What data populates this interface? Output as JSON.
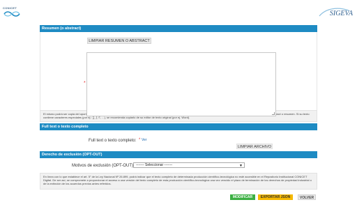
{
  "header": {
    "left_logo_text": "CONICET",
    "right_logo_text": "SIGEVA"
  },
  "resumen": {
    "section_title": "Resumen (o abstract)",
    "clear_button": "LIMPIAR RESUMEN O ABSTRACT",
    "textarea_value": "",
    "required_mark": "*",
    "info_text": "El mismo podrá ser copia del oportunamente enviado a la editorial y en el idioma de la publicación. Puede copiar (ctrl+c) el abstract y pegarlo (ctrl+v) en el cuadro de texto bajo el título Abstract o resumen. Si su texto contiene caracteres especiales (por ej.: ∑, ∫, ℂ, ...), se recomienda copiarlo de su editor de texto original (por ej. Word)."
  },
  "fulltext": {
    "section_title": "Full text o texto completo",
    "label": "Full text o texto completo:",
    "required_mark": "*",
    "ver_link": "Ver",
    "clear_button": "LIMPIAR ARCHIVO"
  },
  "optout": {
    "section_title": "Derecho de exclusión (OPT-OUT)",
    "label": "Motivos de exclusión (OPT-OUT):",
    "select_value": "------- Seleccionar -------",
    "info_text": "En línea con lo que establece el art. 5° de la Ley Nacional Nº 26.899, podrá indicar que el texto completo de determinada producción científico-tecnológica no esté accesible en el Repositorio Institucional CONICET Digital. De ser así, se compromete a proporcionar el acceso a una versión del texto completo de esta producción científico-tecnológica una vez vencido el plazo de terminación de los derechos de propiedad industrial o de la extinción de los acuerdos previos antes referidos."
  },
  "actions": {
    "modify": "MODIFICAR",
    "export": "EXPORTAR JSON",
    "back": "VOLVER"
  },
  "colors": {
    "section_header": "#1e8bc3",
    "modify_button": "#3cb043",
    "export_button": "#f5b800",
    "required": "#e53030"
  }
}
